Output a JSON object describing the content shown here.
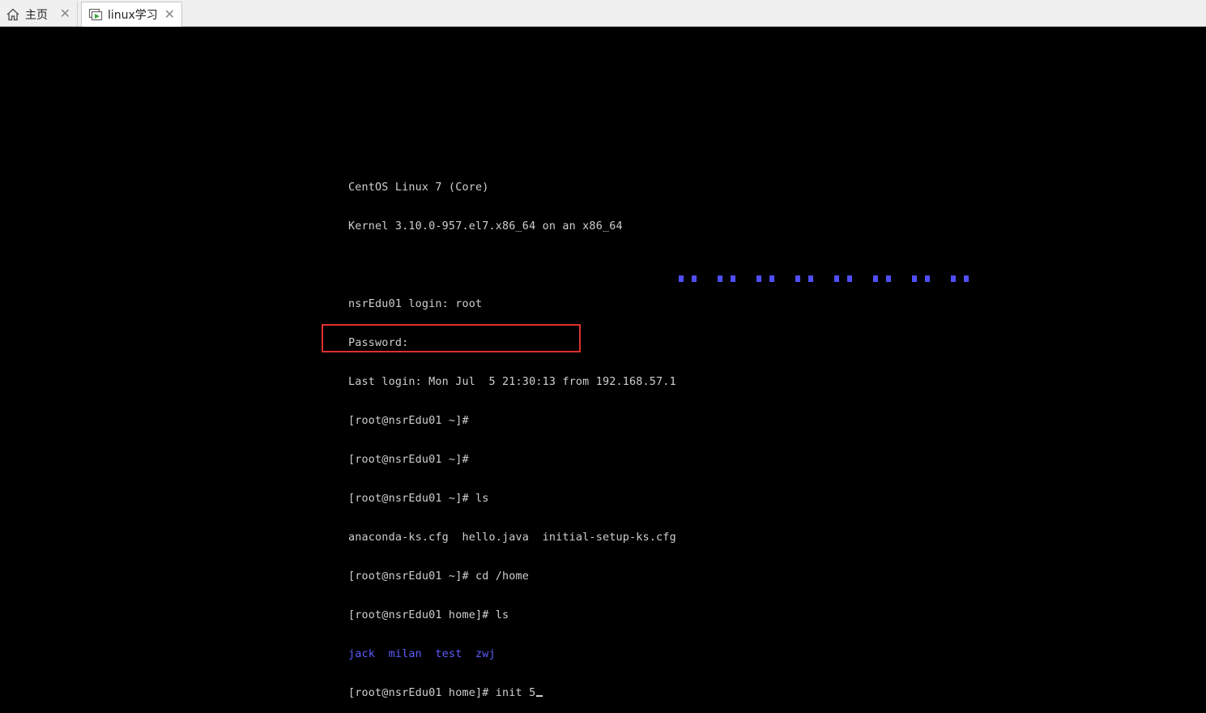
{
  "tabs": [
    {
      "label": "主页",
      "icon": "home-icon",
      "close": "✕"
    },
    {
      "label": "linux学习",
      "icon": "vm-icon",
      "close": "✕",
      "active": true
    }
  ],
  "terminal": {
    "lines": [
      "CentOS Linux 7 (Core)",
      "Kernel 3.10.0-957.el7.x86_64 on an x86_64",
      "",
      "nsrEdu01 login: root",
      "Password:",
      "Last login: Mon Jul  5 21:30:13 from 192.168.57.1",
      "[root@nsrEdu01 ~]#",
      "[root@nsrEdu01 ~]#",
      "[root@nsrEdu01 ~]# ls",
      "anaconda-ks.cfg  hello.java  initial-setup-ks.cfg",
      "[root@nsrEdu01 ~]# cd /home",
      "[root@nsrEdu01 home]# ls"
    ],
    "home_dirs": "jack  milan  test  zwj",
    "current_prompt": "[root@nsrEdu01 home]# init 5"
  },
  "colors": {
    "terminal_text": "#cfcfcf",
    "directory_blue": "#5d5dff",
    "highlight_red": "#e0302e"
  }
}
